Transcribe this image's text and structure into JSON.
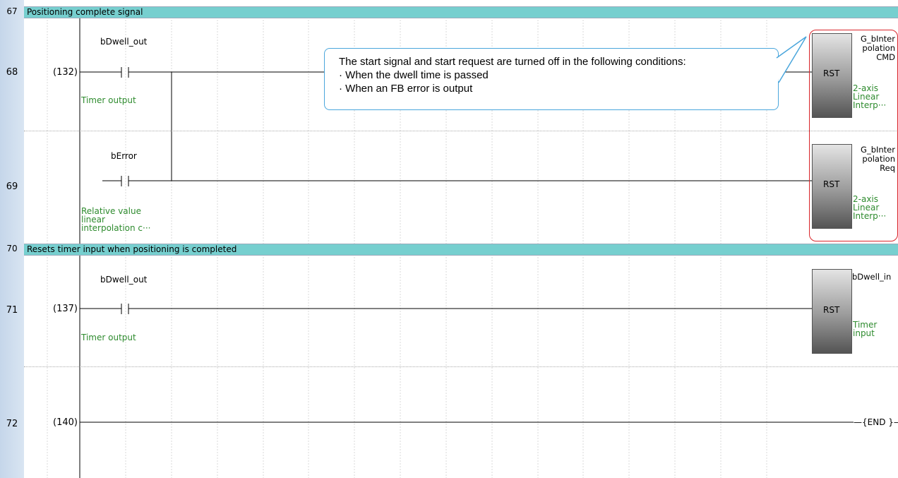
{
  "rows": [
    {
      "step": "67",
      "comment": "Positioning complete signal"
    },
    {
      "step": "68",
      "line": "(132)",
      "contact": "bDwell_out",
      "contact_comment": "Timer output",
      "coil_instruction": "RST",
      "coil_operand": "G_bInter\npolation\nCMD",
      "coil_comment": "2-axis\nLinear\nInterp···"
    },
    {
      "step": "69",
      "contact": "bError",
      "contact_comment": "Relative value\nlinear\ninterpolation c···",
      "coil_instruction": "RST",
      "coil_operand": "G_bInter\npolation\nReq",
      "coil_comment": "2-axis\nLinear\nInterp···"
    },
    {
      "step": "70",
      "comment": "Resets timer input when positioning is completed"
    },
    {
      "step": "71",
      "line": "(137)",
      "contact": "bDwell_out",
      "contact_comment": "Timer output",
      "coil_instruction": "RST",
      "coil_operand": "bDwell_in",
      "coil_comment": "Timer\ninput"
    },
    {
      "step": "72",
      "line": "(140)",
      "end_label": "—{END }—"
    }
  ],
  "callout": {
    "line1": "The start signal and start request are turned off in the following conditions:",
    "line2": "· When the dwell time is passed",
    "line3": "· When an FB error is output"
  },
  "colors": {
    "comment_bar": "#76cfcf",
    "highlight": "#d9252a",
    "callout_border": "#4aa6dc",
    "comment_text": "#2e8b2e"
  }
}
